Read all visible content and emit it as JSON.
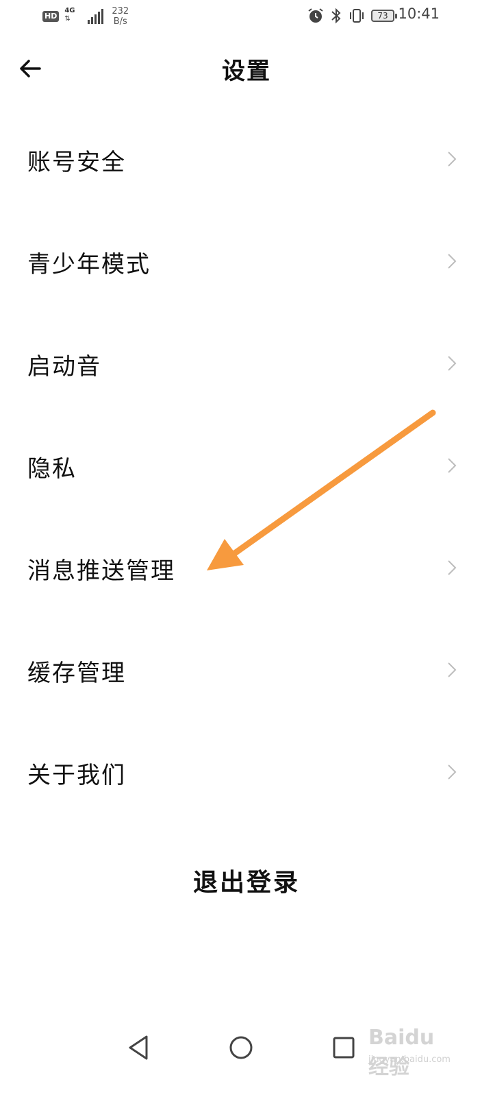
{
  "status_bar": {
    "hd": "HD",
    "network": "4G",
    "speed_value": "232",
    "speed_unit": "B/s",
    "battery": "73",
    "time": "10:41"
  },
  "header": {
    "title": "设置",
    "back_icon": "arrow-left-icon"
  },
  "menu": {
    "items": [
      {
        "label": "账号安全"
      },
      {
        "label": "青少年模式"
      },
      {
        "label": "启动音"
      },
      {
        "label": "隐私"
      },
      {
        "label": "消息推送管理"
      },
      {
        "label": "缓存管理"
      },
      {
        "label": "关于我们"
      }
    ],
    "chevron_icon": "chevron-right-icon"
  },
  "logout_label": "退出登录",
  "annotation": {
    "type": "arrow",
    "color": "#F79A3E",
    "target": "消息推送管理"
  },
  "watermark": {
    "main": "Baidu 经验",
    "sub": "jingyan.baidu.com"
  },
  "nav_bar": {
    "icons": [
      "back-triangle-icon",
      "home-circle-icon",
      "recents-square-icon"
    ]
  }
}
